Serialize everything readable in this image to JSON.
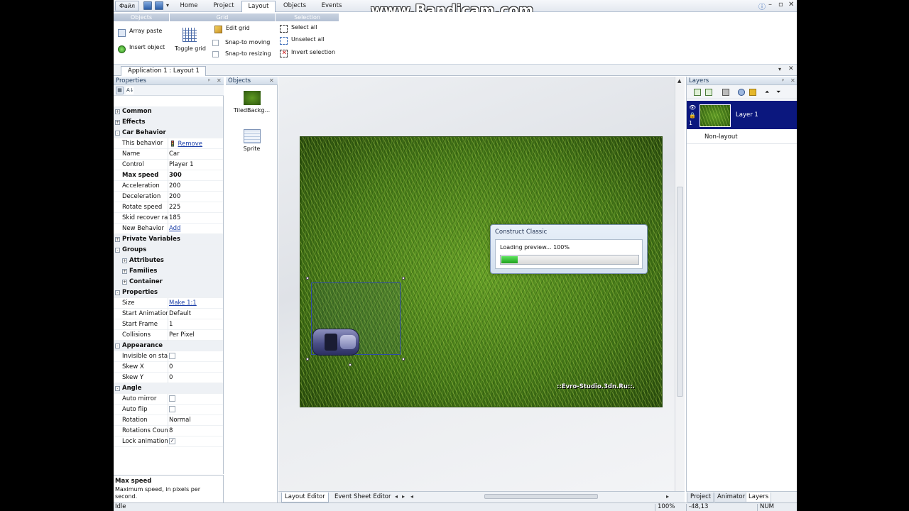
{
  "watermark": "www.Bandicam.com",
  "titlebar": {
    "file_label": "Файл",
    "tabs": [
      "Home",
      "Project",
      "Layout",
      "Objects",
      "Events"
    ],
    "active_tab": "Layout"
  },
  "ribbon": {
    "groups": [
      "Objects",
      "Grid",
      "Selection"
    ],
    "objects": {
      "array_paste": "Array paste",
      "insert_object": "Insert object"
    },
    "grid": {
      "toggle_grid": "Toggle grid",
      "edit_grid": "Edit grid",
      "snap_moving": "Snap-to moving",
      "snap_resizing": "Snap-to resizing"
    },
    "selection": {
      "select_all": "Select all",
      "unselect_all": "Unselect all",
      "invert_selection": "Invert selection"
    }
  },
  "document_tab": "Application 1 : Layout 1",
  "properties": {
    "title": "Properties",
    "rows": [
      {
        "kind": "cat",
        "name": "Common",
        "sign": "+"
      },
      {
        "kind": "cat",
        "name": "Effects",
        "sign": "+"
      },
      {
        "kind": "cat",
        "name": "Car Behavior",
        "sign": "-"
      },
      {
        "kind": "prop",
        "name": "This behavior",
        "value": "Remove",
        "link": true,
        "icon": true
      },
      {
        "kind": "prop",
        "name": "Name",
        "value": "Car"
      },
      {
        "kind": "prop",
        "name": "Control",
        "value": "Player 1"
      },
      {
        "kind": "prop",
        "name": "Max speed",
        "value": "300",
        "bold": true
      },
      {
        "kind": "prop",
        "name": "Acceleration",
        "value": "200"
      },
      {
        "kind": "prop",
        "name": "Deceleration",
        "value": "200"
      },
      {
        "kind": "prop",
        "name": "Rotate speed",
        "value": "225"
      },
      {
        "kind": "prop",
        "name": "Skid recover rat",
        "value": "185"
      },
      {
        "kind": "prop",
        "name": "New Behavior",
        "value": "Add",
        "link": true
      },
      {
        "kind": "cat",
        "name": "Private Variables",
        "sign": "+"
      },
      {
        "kind": "cat",
        "name": "Groups",
        "sign": "-"
      },
      {
        "kind": "sub",
        "name": "Attributes",
        "sign": "+"
      },
      {
        "kind": "sub",
        "name": "Families",
        "sign": "+"
      },
      {
        "kind": "sub",
        "name": "Container",
        "sign": "+"
      },
      {
        "kind": "cat",
        "name": "Properties",
        "sign": "-"
      },
      {
        "kind": "prop",
        "name": "Size",
        "value": "Make 1:1",
        "link": true
      },
      {
        "kind": "prop",
        "name": "Start Animation",
        "value": "Default"
      },
      {
        "kind": "prop",
        "name": "Start Frame",
        "value": "1"
      },
      {
        "kind": "prop",
        "name": "Collisions",
        "value": "Per Pixel"
      },
      {
        "kind": "cat",
        "name": "Appearance",
        "sign": "-"
      },
      {
        "kind": "prop",
        "name": "Invisible on star",
        "checkbox": false
      },
      {
        "kind": "prop",
        "name": "Skew X",
        "value": "0"
      },
      {
        "kind": "prop",
        "name": "Skew Y",
        "value": "0"
      },
      {
        "kind": "cat",
        "name": "Angle",
        "sign": "-"
      },
      {
        "kind": "prop",
        "name": "Auto mirror",
        "checkbox": false
      },
      {
        "kind": "prop",
        "name": "Auto flip",
        "checkbox": false
      },
      {
        "kind": "prop",
        "name": "Rotation",
        "value": "Normal"
      },
      {
        "kind": "prop",
        "name": "Rotations Coun",
        "value": "8"
      },
      {
        "kind": "prop",
        "name": "Lock animation",
        "checkbox": true
      }
    ],
    "help_title": "Max speed",
    "help_text": "Maximum speed, in pixels per second."
  },
  "objects_panel": {
    "title": "Objects",
    "items": [
      {
        "name": "TiledBackg...",
        "icon": "tiled-background-icon"
      },
      {
        "name": "Sprite",
        "icon": "sprite-icon"
      }
    ]
  },
  "layout": {
    "overlay_text": "::Evro-Studio.3dn.Ru::."
  },
  "dialog": {
    "title": "Construct Classic",
    "message": "Loading preview... 100%",
    "progress_fraction": 0.12
  },
  "editor_tabs": [
    "Layout Editor",
    "Event Sheet Editor"
  ],
  "layers_panel": {
    "title": "Layers",
    "layer": {
      "name": "Layer 1",
      "number": "1"
    },
    "non_layout": "Non-layout",
    "bottom_tabs": [
      "Project",
      "Animator",
      "Layers"
    ]
  },
  "status": {
    "text": "Idle",
    "zoom": "100%",
    "coords": "-48,13",
    "num": "NUM"
  },
  "colors": {
    "selection_blue": "#0b177e",
    "progress_green": "#1fa21f"
  }
}
